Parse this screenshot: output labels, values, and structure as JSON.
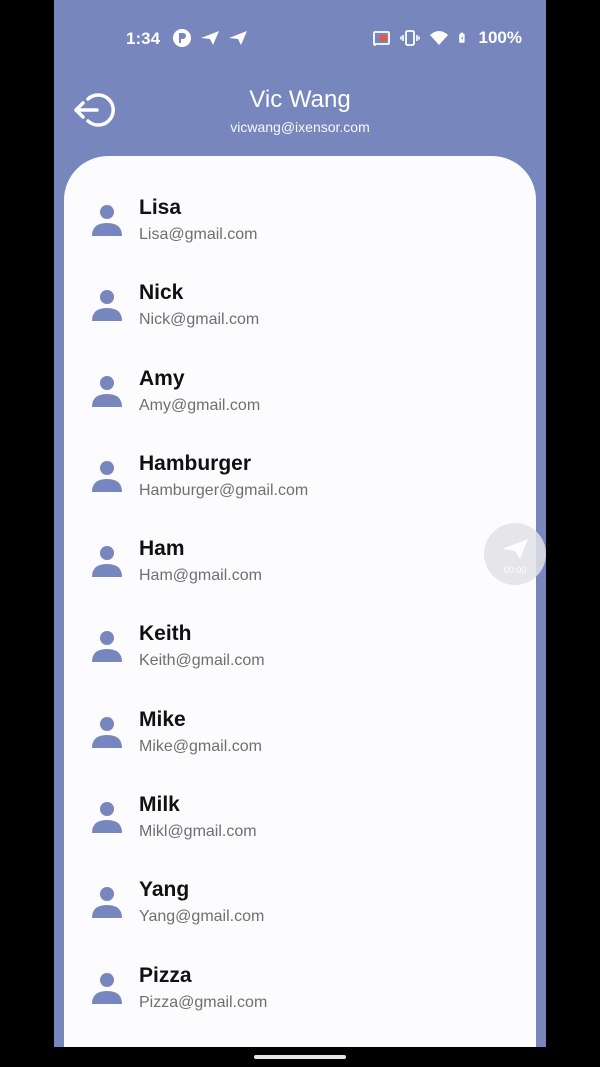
{
  "status_bar": {
    "time": "1:34",
    "battery": "100%",
    "icons": [
      "app-icon",
      "send-icon",
      "send-icon",
      "cast-icon",
      "vibrate-icon",
      "wifi-icon",
      "battery-icon"
    ]
  },
  "header": {
    "user_name": "Vic Wang",
    "user_email": "vicwang@ixensor.com",
    "logout_icon": "logout-icon"
  },
  "contacts": [
    {
      "name": "Lisa",
      "email": "Lisa@gmail.com"
    },
    {
      "name": "Nick",
      "email": "Nick@gmail.com"
    },
    {
      "name": "Amy",
      "email": "Amy@gmail.com"
    },
    {
      "name": "Hamburger",
      "email": "Hamburger@gmail.com"
    },
    {
      "name": "Ham",
      "email": "Ham@gmail.com"
    },
    {
      "name": "Keith",
      "email": "Keith@gmail.com"
    },
    {
      "name": "Mike",
      "email": "Mike@gmail.com"
    },
    {
      "name": "Milk",
      "email": "Mikl@gmail.com"
    },
    {
      "name": "Yang",
      "email": "Yang@gmail.com"
    },
    {
      "name": "Pizza",
      "email": "Pizza@gmail.com"
    }
  ],
  "floating_bubble": {
    "timer": "00:00"
  },
  "colors": {
    "primary": "#7786bd",
    "card": "#fcfbfe",
    "name": "#111111",
    "email": "#6f6f6f"
  }
}
